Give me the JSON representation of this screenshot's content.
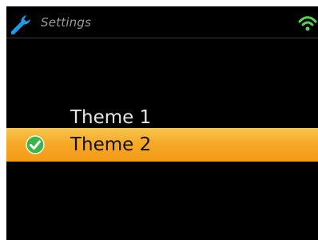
{
  "header": {
    "title": "Settings",
    "left_icon": "wrench-icon",
    "right_icon": "wifi-icon"
  },
  "themes": {
    "items": [
      {
        "label": "Theme 1",
        "selected": false
      },
      {
        "label": "Theme 2",
        "selected": true
      }
    ]
  },
  "colors": {
    "background": "#000000",
    "highlight": "#f7a928",
    "accent_blue": "#1e9be8",
    "wifi_green": "#5bd15b",
    "check_green": "#3bb54a"
  }
}
